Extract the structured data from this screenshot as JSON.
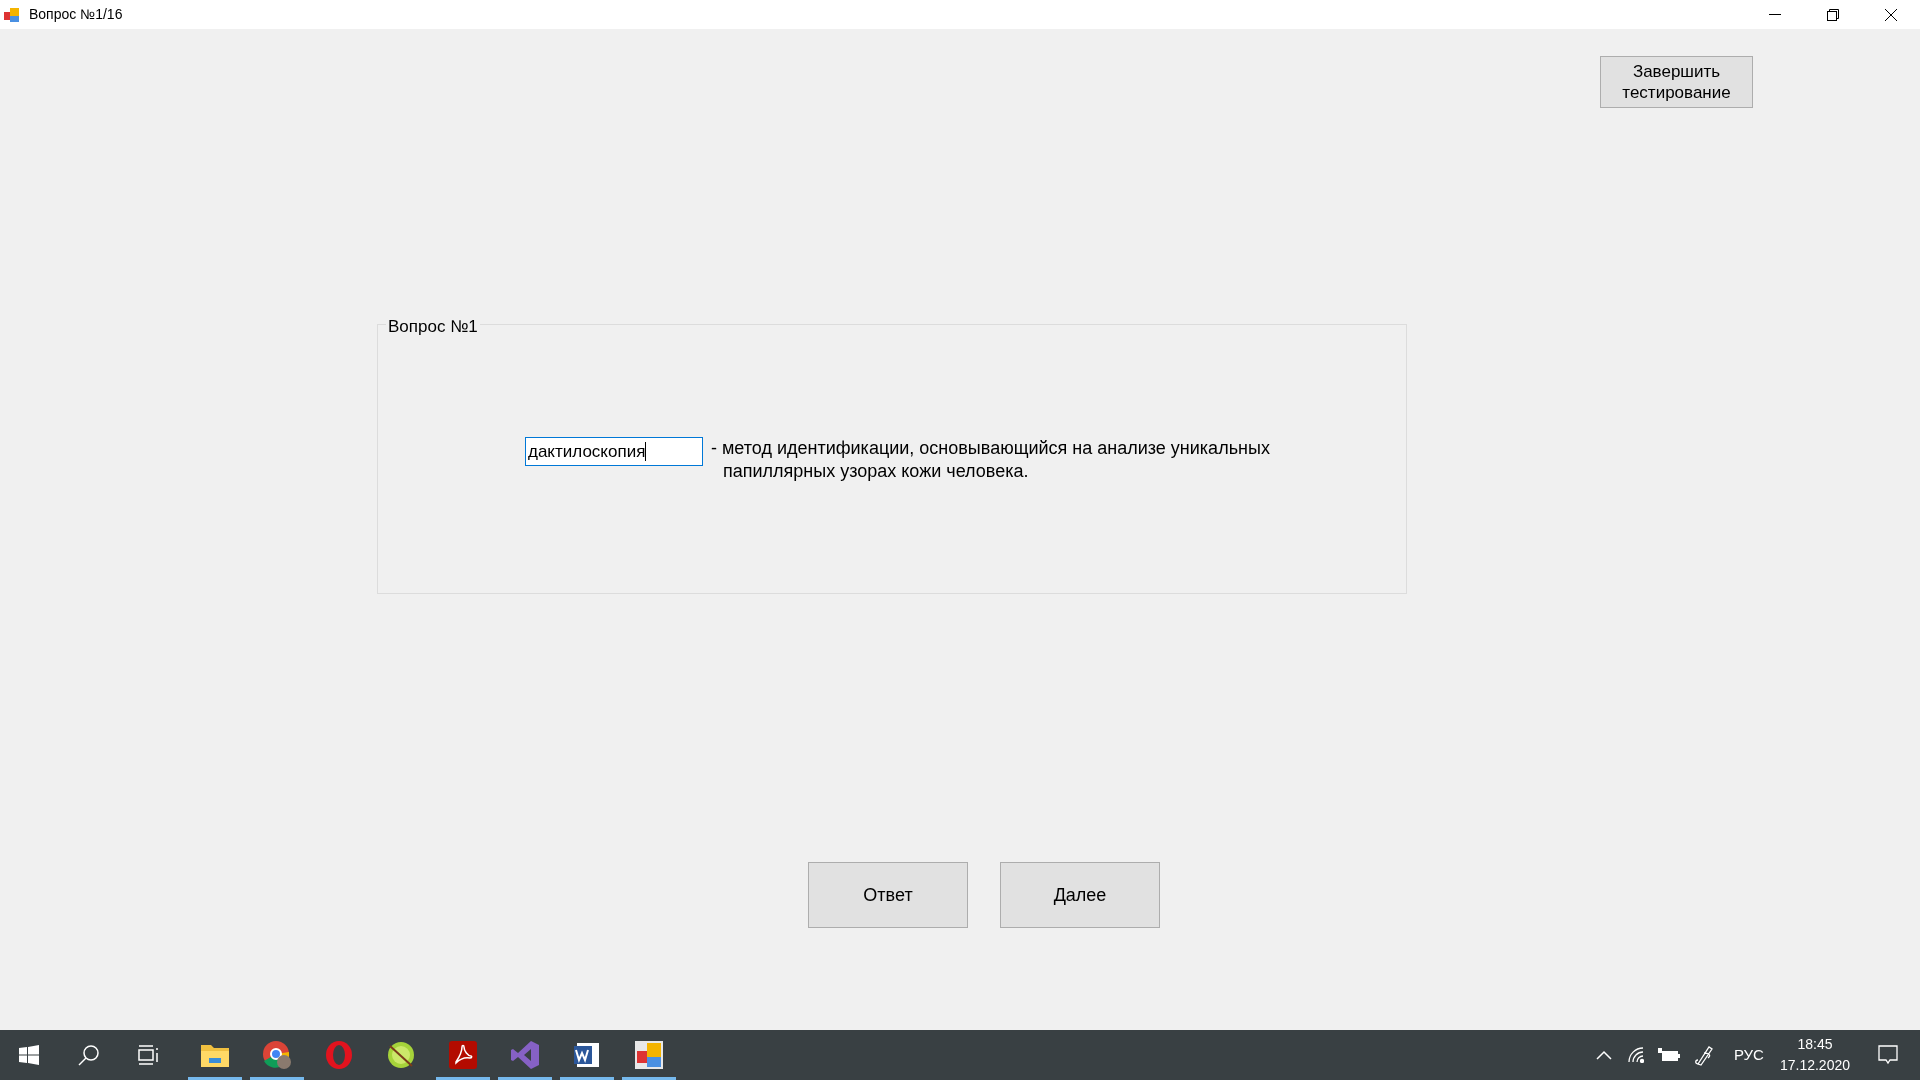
{
  "window": {
    "title": "Вопрос №1/16"
  },
  "finish_button": "Завершить тестирование",
  "question_group": {
    "title": "Вопрос №1",
    "answer": {
      "value": "дактилоскопия",
      "focused": true
    },
    "text_lines": [
      "- метод идентификации, основывающийся на анализе уникальных",
      "папиллярных узорах кожи человека."
    ]
  },
  "buttons": [
    "Ответ",
    "Далее"
  ],
  "taskbar": {
    "apps": [
      {
        "kind": "explorer",
        "running": true
      },
      {
        "kind": "chrome",
        "running": true
      },
      {
        "kind": "opera",
        "running": false
      },
      {
        "kind": "lime",
        "running": false
      },
      {
        "kind": "acrobat",
        "running": true
      },
      {
        "kind": "studio",
        "running": true
      },
      {
        "kind": "word",
        "running": true
      },
      {
        "kind": "form",
        "running": true
      }
    ],
    "language": "РУС",
    "time": "18:45",
    "date": "17.12.2020"
  }
}
